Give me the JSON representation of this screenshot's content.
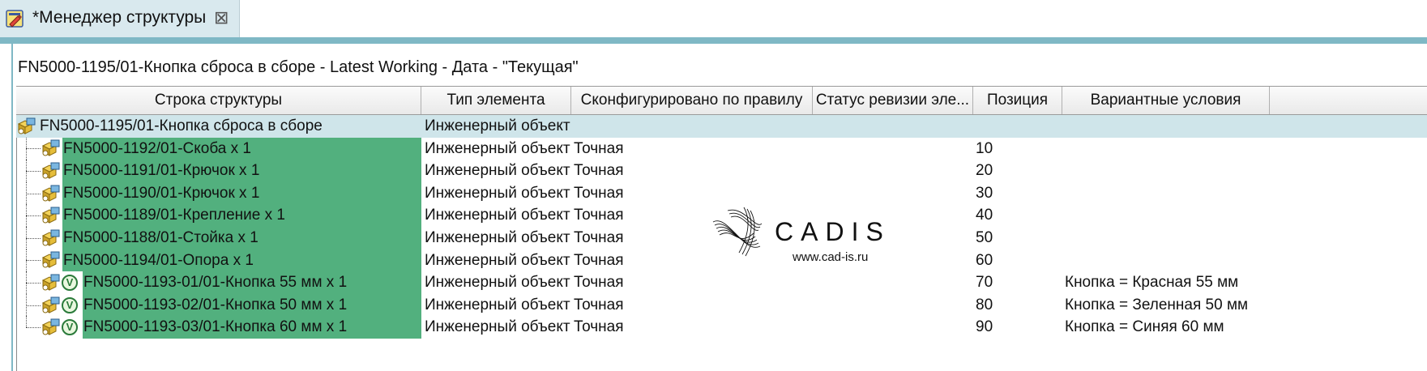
{
  "tab": {
    "title": "*Менеджер структуры",
    "close_glyph": "⊠"
  },
  "breadcrumb": "FN5000-1195/01-Кнопка сброса в сборе - Latest Working - Дата - \"Текущая\"",
  "columns": [
    "Строка структуры",
    "Тип элемента",
    "Сконфигурировано по правилу",
    "Статус ревизии эле...",
    "Позиция",
    "Вариантные условия"
  ],
  "rows": [
    {
      "name": "FN5000-1195/01-Кнопка сброса в сборе",
      "type": "Инженерный объект",
      "configured": "",
      "status": "",
      "position": "",
      "variant": "",
      "level": 0,
      "variant_badge": false,
      "selected": true
    },
    {
      "name": "FN5000-1192/01-Скоба x 1",
      "type": "Инженерный объект",
      "configured": "Точная",
      "status": "",
      "position": "10",
      "variant": "",
      "level": 1,
      "variant_badge": false,
      "selected": false
    },
    {
      "name": "FN5000-1191/01-Крючок x 1",
      "type": "Инженерный объект",
      "configured": "Точная",
      "status": "",
      "position": "20",
      "variant": "",
      "level": 1,
      "variant_badge": false,
      "selected": false
    },
    {
      "name": "FN5000-1190/01-Крючок x 1",
      "type": "Инженерный объект",
      "configured": "Точная",
      "status": "",
      "position": "30",
      "variant": "",
      "level": 1,
      "variant_badge": false,
      "selected": false
    },
    {
      "name": "FN5000-1189/01-Крепление x 1",
      "type": "Инженерный объект",
      "configured": "Точная",
      "status": "",
      "position": "40",
      "variant": "",
      "level": 1,
      "variant_badge": false,
      "selected": false
    },
    {
      "name": "FN5000-1188/01-Стойка x 1",
      "type": "Инженерный объект",
      "configured": "Точная",
      "status": "",
      "position": "50",
      "variant": "",
      "level": 1,
      "variant_badge": false,
      "selected": false
    },
    {
      "name": "FN5000-1194/01-Опора x 1",
      "type": "Инженерный объект",
      "configured": "Точная",
      "status": "",
      "position": "60",
      "variant": "",
      "level": 1,
      "variant_badge": false,
      "selected": false
    },
    {
      "name": "FN5000-1193-01/01-Кнопка 55 мм x 1",
      "type": "Инженерный объект",
      "configured": "Точная",
      "status": "",
      "position": "70",
      "variant": "Кнопка = Красная 55 мм",
      "level": 1,
      "variant_badge": true,
      "selected": false
    },
    {
      "name": "FN5000-1193-02/01-Кнопка 50 мм x 1",
      "type": "Инженерный объект",
      "configured": "Точная",
      "status": "",
      "position": "80",
      "variant": "Кнопка = Зеленная 50 мм",
      "level": 1,
      "variant_badge": true,
      "selected": false
    },
    {
      "name": "FN5000-1193-03/01-Кнопка 60 мм x 1",
      "type": "Инженерный объект",
      "configured": "Точная",
      "status": "",
      "position": "90",
      "variant": "Кнопка = Синяя 60 мм",
      "level": 1,
      "variant_badge": true,
      "selected": false
    }
  ],
  "watermark": {
    "brand": "CADIS",
    "url": "www.cad-is.ru"
  },
  "icons": {
    "tab": "structure-manager-icon",
    "part": "engineering-item-icon",
    "variant": "variant-v-icon"
  },
  "colors": {
    "selected_row": "#cfe5ea",
    "item_highlight": "#52b07e",
    "frame": "#7fb8c5",
    "tab_bg": "#d9e9ee"
  }
}
